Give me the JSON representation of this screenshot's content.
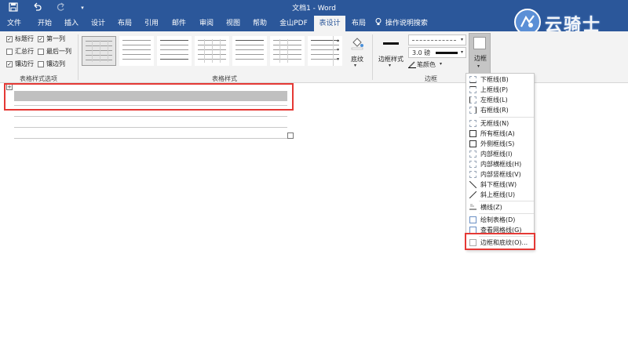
{
  "title_bar": {
    "doc_title": "文档1 - Word",
    "qat": {
      "save_icon": "save-icon",
      "undo_icon": "undo-icon",
      "redo_icon": "redo-icon",
      "customize_icon": "chevron-down-icon"
    }
  },
  "watermark": {
    "text": "云骑士",
    "icon": "knight-logo-icon"
  },
  "tabs": [
    {
      "label": "文件"
    },
    {
      "label": "开始"
    },
    {
      "label": "插入"
    },
    {
      "label": "设计"
    },
    {
      "label": "布局"
    },
    {
      "label": "引用"
    },
    {
      "label": "邮件"
    },
    {
      "label": "审阅"
    },
    {
      "label": "视图"
    },
    {
      "label": "帮助"
    },
    {
      "label": "金山PDF"
    },
    {
      "label": "表设计",
      "active": true
    },
    {
      "label": "布局"
    }
  ],
  "tell_me": {
    "label": "操作说明搜索",
    "icon": "lightbulb-icon"
  },
  "ribbon": {
    "table_style_options": {
      "group_label": "表格样式选项",
      "options": [
        {
          "label": "标题行",
          "checked": true
        },
        {
          "label": "第一列",
          "checked": true
        },
        {
          "label": "汇总行",
          "checked": false
        },
        {
          "label": "最后一列",
          "checked": false
        },
        {
          "label": "镶边行",
          "checked": true
        },
        {
          "label": "镶边列",
          "checked": false
        }
      ]
    },
    "table_styles": {
      "group_label": "表格样式",
      "shading_label": "底纹",
      "shading_icon": "paint-bucket-icon"
    },
    "borders": {
      "group_label": "边框",
      "border_styles_label": "边框样式",
      "weight_value": "3.0 磅",
      "pen_color_label": "笔颜色",
      "borders_button_label": "边框",
      "pen_color": "#000000"
    }
  },
  "border_menu": {
    "items": [
      {
        "label": "下框线(B)",
        "icon": "bottom-border-icon"
      },
      {
        "label": "上框线(P)",
        "icon": "top-border-icon"
      },
      {
        "label": "左框线(L)",
        "icon": "left-border-icon"
      },
      {
        "label": "右框线(R)",
        "icon": "right-border-icon"
      },
      {
        "label": "无框线(N)",
        "icon": "no-border-icon"
      },
      {
        "label": "所有框线(A)",
        "icon": "all-borders-icon"
      },
      {
        "label": "外侧框线(S)",
        "icon": "outside-borders-icon"
      },
      {
        "label": "内部框线(I)",
        "icon": "inside-borders-icon"
      },
      {
        "label": "内部横框线(H)",
        "icon": "inside-horizontal-border-icon"
      },
      {
        "label": "内部竖框线(V)",
        "icon": "inside-vertical-border-icon"
      },
      {
        "label": "斜下框线(W)",
        "icon": "diagonal-down-border-icon"
      },
      {
        "label": "斜上框线(U)",
        "icon": "diagonal-up-border-icon"
      },
      {
        "label": "横线(Z)",
        "icon": "horizontal-line-icon"
      },
      {
        "label": "绘制表格(D)",
        "icon": "draw-table-icon"
      },
      {
        "label": "查看网格线(G)",
        "icon": "view-gridlines-icon"
      },
      {
        "label": "边框和底纹(O)...",
        "icon": "borders-shading-icon"
      }
    ]
  },
  "colors": {
    "ribbon_blue": "#2b579a",
    "highlight_red": "#e53935",
    "selected_row_gray": "#c0c0c0"
  }
}
